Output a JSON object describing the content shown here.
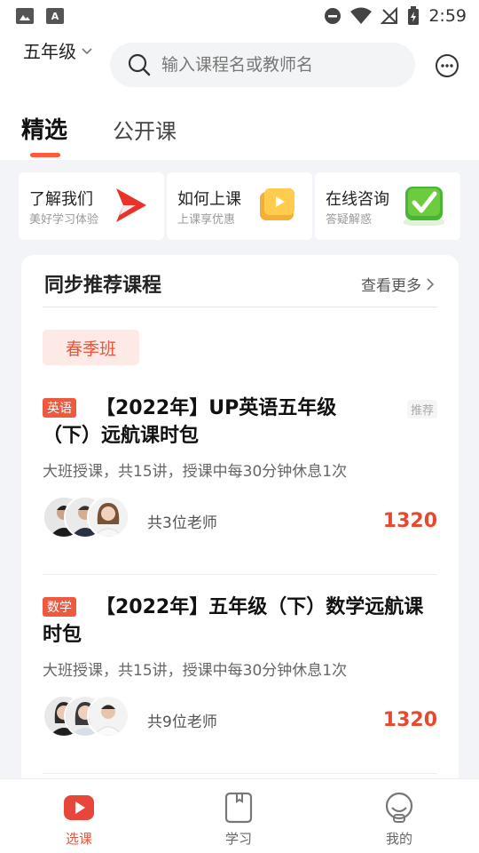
{
  "status_bar": {
    "time": "2:59"
  },
  "header": {
    "grade": "五年级",
    "search_placeholder": "输入课程名或教师名",
    "tabs": [
      {
        "label": "精选",
        "active": true
      },
      {
        "label": "公开课",
        "active": false
      }
    ]
  },
  "quick_links": [
    {
      "title": "了解我们",
      "subtitle": "美好学习体验",
      "icon": "play-logo-icon"
    },
    {
      "title": "如何上课",
      "subtitle": "上课享优惠",
      "icon": "video-box-icon"
    },
    {
      "title": "在线咨询",
      "subtitle": "答疑解惑",
      "icon": "green-check-icon"
    }
  ],
  "panel": {
    "title": "同步推荐课程",
    "more_label": "查看更多",
    "season_tag": "春季班",
    "courses": [
      {
        "subject": "英语",
        "title": "【2022年】UP英语五年级（下）远航课时包",
        "badge": "推荐",
        "description": "大班授课，共15讲，授课中每30分钟休息1次",
        "teachers": "共3位老师",
        "price": "1320"
      },
      {
        "subject": "数学",
        "title": "【2022年】五年级（下）数学远航课时包",
        "description": "大班授课，共15讲，授课中每30分钟休息1次",
        "teachers": "共9位老师",
        "price": "1320"
      }
    ]
  },
  "bottom_nav": [
    {
      "label": "选课",
      "icon": "play-icon",
      "active": true
    },
    {
      "label": "学习",
      "icon": "book-icon",
      "active": false
    },
    {
      "label": "我的",
      "icon": "profile-icon",
      "active": false
    }
  ],
  "colors": {
    "accent": "#e8553a",
    "price": "#e64a2e",
    "background": "#f3f4f7"
  }
}
